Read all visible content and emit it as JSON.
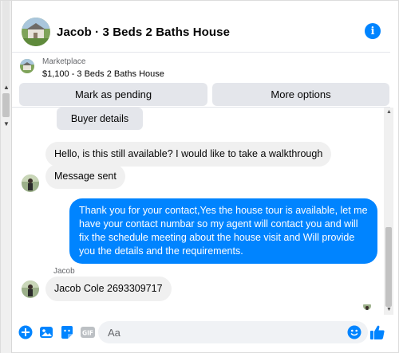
{
  "header": {
    "title": "Jacob · 3 Beds 2 Baths House"
  },
  "listing": {
    "label": "Marketplace",
    "price_title": "$1,100 - 3 Beds 2 Baths House",
    "mark_pending_label": "Mark as pending",
    "more_options_label": "More options"
  },
  "chat": {
    "buyer_details_label": "Buyer details",
    "messages": [
      {
        "from": "them",
        "text": "Hello, is this still available? I would like to take a walkthrough"
      },
      {
        "from": "them",
        "text": "Message sent"
      },
      {
        "from": "me",
        "text": "Thank you for your contact,Yes the house tour is available, let me have your contact numbar so my agent will contact you and will fix the schedule meeting about the house visit and  Will provide you the details and the requirements."
      },
      {
        "from": "them",
        "text": "Jacob Cole 2693309717"
      }
    ],
    "sender_name": "Jacob"
  },
  "composer": {
    "placeholder": "Aa",
    "gif_label": "GIF"
  },
  "colors": {
    "accent": "#0084ff",
    "bubble_grey": "#f0f0f0",
    "button_grey": "#e4e6eb"
  },
  "icons": [
    "info-icon",
    "plus-circle-icon",
    "image-icon",
    "sticker-icon",
    "gif-icon",
    "emoji-icon",
    "like-icon"
  ]
}
